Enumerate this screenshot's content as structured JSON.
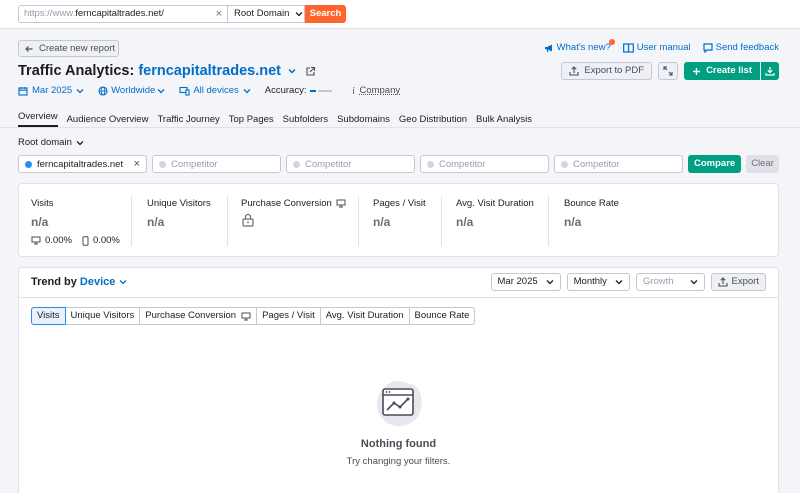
{
  "topbar": {
    "url_prefix": "https://www.",
    "url_value": "ferncapitaltrades.net/",
    "clear_icon": "×",
    "root_domain": "Root Domain",
    "search_label": "Search"
  },
  "header": {
    "create_report": "Create new report",
    "whats_new": "What's new?",
    "user_manual": "User manual",
    "send_feedback": "Send feedback",
    "title_prefix": "Traffic Analytics:",
    "domain": "ferncapitaltrades.net",
    "export_pdf": "Export to PDF",
    "create_list": "Create list"
  },
  "filters": {
    "date": "Mar 2025",
    "location": "Worldwide",
    "devices": "All devices",
    "accuracy_label": "Accuracy:",
    "company": "Company"
  },
  "tabs": [
    "Overview",
    "Audience Overview",
    "Traffic Journey",
    "Top Pages",
    "Subfolders",
    "Subdomains",
    "Geo Distribution",
    "Bulk Analysis"
  ],
  "compare": {
    "root_domain_label": "Root domain",
    "main_domain": "ferncapitaltrades.net",
    "competitor_placeholder": "Competitor",
    "compare_label": "Compare",
    "clear_label": "Clear"
  },
  "metrics": {
    "visits": {
      "label": "Visits",
      "value": "n/a",
      "desktop": "0.00%",
      "mobile": "0.00%"
    },
    "unique_visitors": {
      "label": "Unique Visitors",
      "value": "n/a"
    },
    "purchase_conversion": {
      "label": "Purchase Conversion"
    },
    "pages_visit": {
      "label": "Pages / Visit",
      "value": "n/a"
    },
    "avg_duration": {
      "label": "Avg. Visit Duration",
      "value": "n/a"
    },
    "bounce_rate": {
      "label": "Bounce Rate",
      "value": "n/a"
    }
  },
  "trend": {
    "title": "Trend by",
    "device": "Device",
    "date": "Mar 2025",
    "period": "Monthly",
    "growth": "Growth",
    "export": "Export",
    "metric_tabs": [
      "Visits",
      "Unique Visitors",
      "Purchase Conversion",
      "Pages / Visit",
      "Avg. Visit Duration",
      "Bounce Rate"
    ],
    "empty_title": "Nothing found",
    "empty_hint": "Try changing your filters."
  },
  "colors": {
    "accent": "#006dca",
    "brand": "#ff642d",
    "green": "#009f81"
  }
}
